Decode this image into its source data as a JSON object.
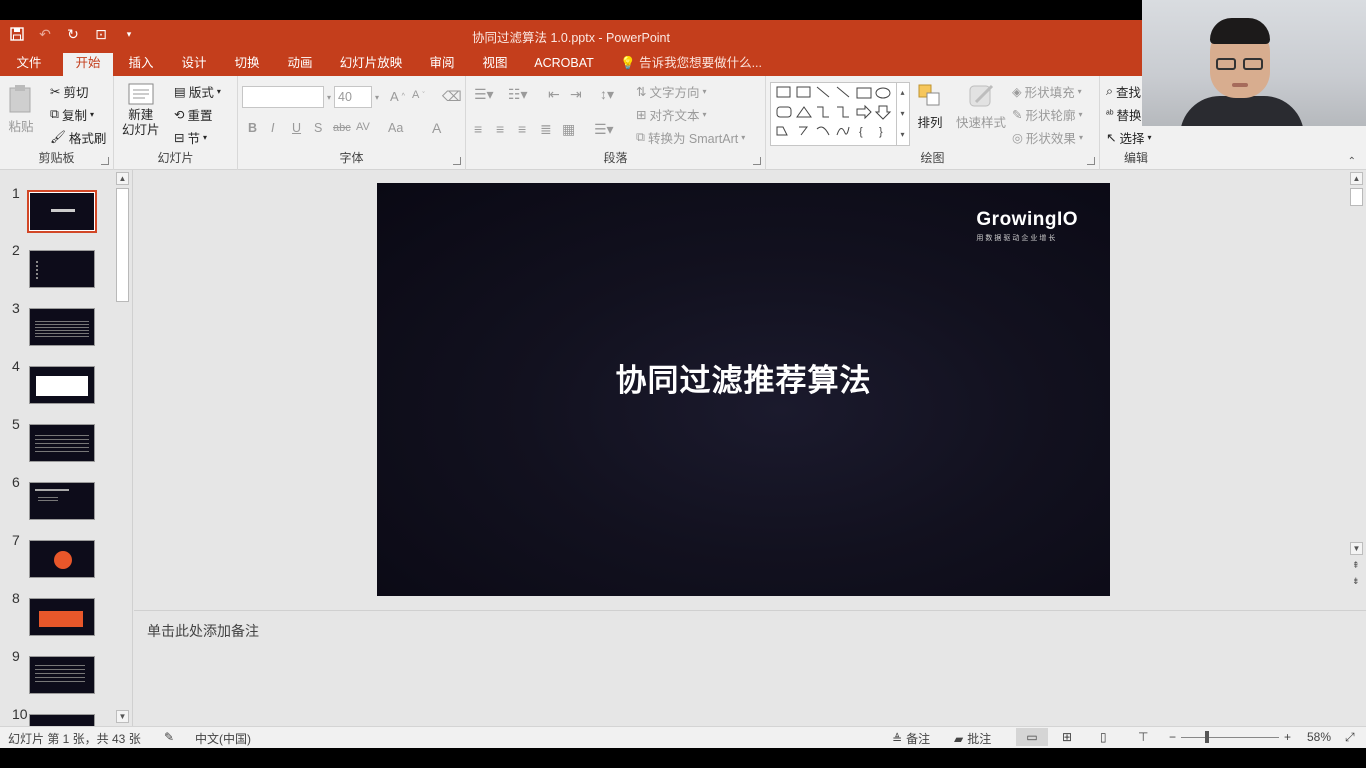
{
  "window": {
    "title": "协同过滤算法 1.0.pptx - PowerPoint"
  },
  "tabs": [
    {
      "label": "文件"
    },
    {
      "label": "开始"
    },
    {
      "label": "插入"
    },
    {
      "label": "设计"
    },
    {
      "label": "切换"
    },
    {
      "label": "动画"
    },
    {
      "label": "幻灯片放映"
    },
    {
      "label": "审阅"
    },
    {
      "label": "视图"
    },
    {
      "label": "ACROBAT"
    }
  ],
  "tell_me": "告诉我您想要做什么...",
  "ribbon": {
    "clipboard": {
      "label": "剪贴板",
      "paste": "粘贴",
      "cut": "剪切",
      "copy": "复制",
      "format_painter": "格式刷"
    },
    "slides": {
      "label": "幻灯片",
      "new_slide_1": "新建",
      "new_slide_2": "幻灯片",
      "layout": "版式",
      "reset": "重置",
      "section": "节"
    },
    "font": {
      "label": "字体",
      "font_name": "",
      "font_size": "40",
      "bold": "B",
      "italic": "I",
      "underline": "U",
      "shadow": "S",
      "strike": "abc",
      "spacing": "AV",
      "case": "Aa",
      "color": "A"
    },
    "paragraph": {
      "label": "段落",
      "text_direction": "文字方向",
      "align_text": "对齐文本",
      "smartart": "转换为 SmartArt"
    },
    "drawing": {
      "label": "绘图",
      "arrange": "排列",
      "quick_styles": "快速样式",
      "shape_fill": "形状填充",
      "shape_outline": "形状轮廓",
      "shape_effects": "形状效果"
    },
    "editing": {
      "label": "编辑",
      "find": "查找",
      "replace": "替换",
      "select": "选择"
    }
  },
  "thumbnails": [
    {
      "num": "1",
      "selected": true
    },
    {
      "num": "2"
    },
    {
      "num": "3"
    },
    {
      "num": "4"
    },
    {
      "num": "5"
    },
    {
      "num": "6"
    },
    {
      "num": "7"
    },
    {
      "num": "8"
    },
    {
      "num": "9"
    },
    {
      "num": "10"
    }
  ],
  "slide": {
    "title": "协同过滤推荐算法",
    "logo": "GrowingIO",
    "logo_sub": "用数据驱动企业增长"
  },
  "notes_placeholder": "单击此处添加备注",
  "status": {
    "slide_info": "幻灯片 第 1 张，共 43 张",
    "language": "中文(中国)",
    "notes": "备注",
    "comments": "批注",
    "zoom": "58%"
  },
  "colors": {
    "accent": "#c43e1c",
    "slide_bg": "#12111f"
  }
}
